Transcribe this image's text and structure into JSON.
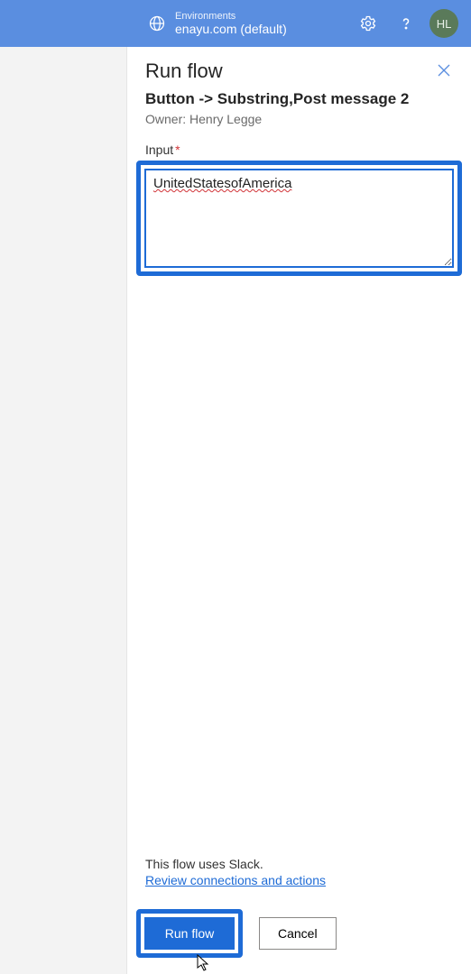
{
  "topbar": {
    "env_label": "Environments",
    "env_value": "enayu.com (default)",
    "avatar_initials": "HL"
  },
  "panel": {
    "title": "Run flow",
    "flow_name": "Button -> Substring,Post message 2",
    "owner_line": "Owner: Henry Legge",
    "input_label": "Input",
    "input_value": "UnitedStatesofAmerica",
    "footer_note": "This flow uses Slack.",
    "review_link": "Review connections and actions",
    "run_button": "Run flow",
    "cancel_button": "Cancel"
  }
}
